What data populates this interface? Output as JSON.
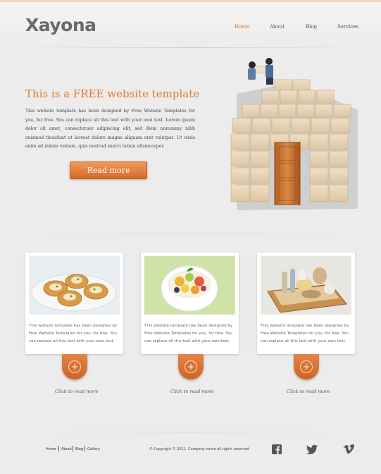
{
  "brand": {
    "logo": "Xayona",
    "accent": "#e0782e"
  },
  "nav": {
    "items": [
      "Home",
      "About",
      "Blog",
      "Services"
    ],
    "active": "Home"
  },
  "hero": {
    "title": "This is a FREE website template",
    "text": "This website template has been designed by Free Website Templates for you, for free. You can replace all this text with your own text. Lorem ipsum dolor sit amet, consectetuer adipiscing elit, sed diem nonummy nibh euismod tincidunt ut lacreet dolore magna aliguam erat volutpat. Ut wisis enim ad minim veniam, quis nostrud exerci tation ullamcorper.",
    "button": "Read more"
  },
  "features": [
    {
      "image": "pastries-photo",
      "text": "This website template has been designed by Free Website Templates for you, for free. You can replace all this text with your own text.",
      "link": "Click to read more"
    },
    {
      "image": "fruit-salad-photo",
      "text": "This website template has been designed by Free Website Templates for you, for free. You can replace all this text with your own text.",
      "link": "Click to read more"
    },
    {
      "image": "spa-basket-photo",
      "text": "This website template has been designed by Free Website Templates for you, for free. You can replace all this text with your own text.",
      "link": "Click to read more"
    }
  ],
  "footer": {
    "links": [
      "Home",
      "About",
      "Blog",
      "Gallery"
    ],
    "copyright": "© Copyright © 2011. Company name all rights reserved",
    "social": [
      "facebook-icon",
      "twitter-icon",
      "vimeo-icon"
    ]
  }
}
